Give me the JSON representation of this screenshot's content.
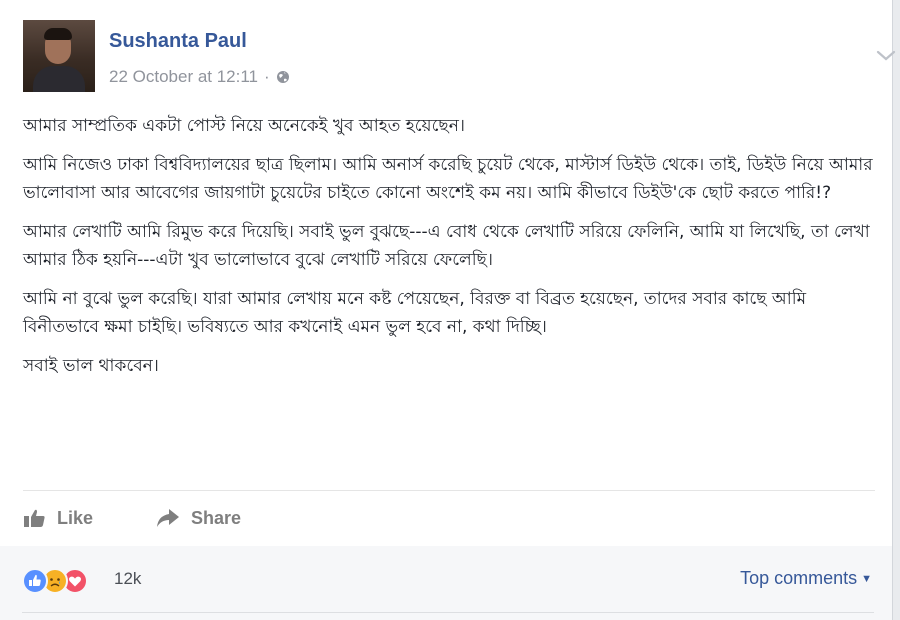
{
  "post": {
    "author": "Sushanta Paul",
    "timestamp": "22 October at 12:11",
    "separator": "·",
    "privacy_icon": "globe-icon",
    "paragraphs": [
      "আমার সাম্প্রতিক একটা পোস্ট নিয়ে অনেকেই খুব আহত হয়েছেন।",
      "আমি নিজেও ঢাকা বিশ্ববিদ্যালয়ের ছাত্র ছিলাম। আমি অনার্স করেছি চুয়েট থেকে, মাস্টার্স ডিইউ থেকে। তাই, ডিইউ নিয়ে আমার ভালোবাসা আর আবেগের জায়গাটা চুয়েটের চাইতে কোনো অংশেই কম নয়। আমি কীভাবে ডিইউ'কে ছোট করতে পারি!?",
      "আমার লেখাটি আমি রিমুভ করে দিয়েছি। সবাই ভুল বুঝছে---এ বোধ থেকে লেখাটি সরিয়ে ফেলিনি, আমি যা লিখেছি, তা লেখা আমার ঠিক হয়নি---এটা খুব ভালোভাবে বুঝে লেখাটি সরিয়ে ফেলেছি।",
      "আমি না বুঝে ভুল করেছি। যারা আমার লেখায় মনে কষ্ট পেয়েছেন, বিরক্ত বা বিব্রত হয়েছেন, তাদের সবার কাছে আমি বিনীতভাবে ক্ষমা চাইছি। ভবিষ্যতে আর কখনোই এমন ভুল হবে না, কথা দিচ্ছি।",
      "সবাই ভাল থাকবেন।"
    ]
  },
  "actions": {
    "like_label": "Like",
    "share_label": "Share"
  },
  "reactions": {
    "icons": [
      "like-icon",
      "sad-icon",
      "love-icon"
    ],
    "colors": {
      "like": "#5890ff",
      "sad": "#f7b125",
      "love": "#f25268"
    },
    "count": "12k"
  },
  "comments": {
    "sort_label": "Top comments"
  }
}
